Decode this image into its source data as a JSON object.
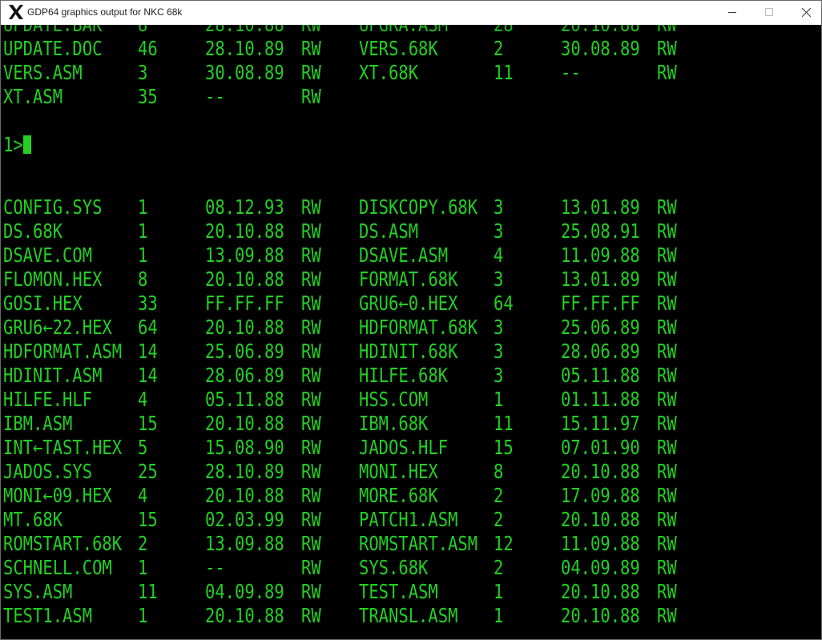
{
  "window": {
    "title": "GDP64 graphics output for NKC 68k",
    "icon": "x-app-icon",
    "controls": [
      "minimize-icon",
      "maximize-icon",
      "close-icon"
    ]
  },
  "terminal": {
    "text_color": "#22d022",
    "background": "#000000",
    "top_listing": [
      [
        "UPDATE.DOC",
        "46",
        "28.10.89",
        "RW",
        "VERS.68K",
        "2",
        "30.08.89",
        "RW"
      ],
      [
        "VERS.ASM",
        "3",
        "30.08.89",
        "RW",
        "XT.68K",
        "11",
        "--",
        "RW"
      ],
      [
        "XT.ASM",
        "35",
        "--",
        "RW",
        "",
        "",
        "",
        ""
      ]
    ],
    "prompt": "1>",
    "listing": [
      [
        "CONFIG.SYS",
        "1",
        "08.12.93",
        "RW",
        "DISKCOPY.68K",
        "3",
        "13.01.89",
        "RW"
      ],
      [
        "DS.68K",
        "1",
        "20.10.88",
        "RW",
        "DS.ASM",
        "3",
        "25.08.91",
        "RW"
      ],
      [
        "DSAVE.COM",
        "1",
        "13.09.88",
        "RW",
        "DSAVE.ASM",
        "4",
        "11.09.88",
        "RW"
      ],
      [
        "FLOMON.HEX",
        "8",
        "20.10.88",
        "RW",
        "FORMAT.68K",
        "3",
        "13.01.89",
        "RW"
      ],
      [
        "GOSI.HEX",
        "33",
        "FF.FF.FF",
        "RW",
        "GRU6←0.HEX",
        "64",
        "FF.FF.FF",
        "RW"
      ],
      [
        "GRU6←22.HEX",
        "64",
        "20.10.88",
        "RW",
        "HDFORMAT.68K",
        "3",
        "25.06.89",
        "RW"
      ],
      [
        "HDFORMAT.ASM",
        "14",
        "25.06.89",
        "RW",
        "HDINIT.68K",
        "3",
        "28.06.89",
        "RW"
      ],
      [
        "HDINIT.ASM",
        "14",
        "28.06.89",
        "RW",
        "HILFE.68K",
        "3",
        "05.11.88",
        "RW"
      ],
      [
        "HILFE.HLF",
        "4",
        "05.11.88",
        "RW",
        "HSS.COM",
        "1",
        "01.11.88",
        "RW"
      ],
      [
        "IBM.ASM",
        "15",
        "20.10.88",
        "RW",
        "IBM.68K",
        "11",
        "15.11.97",
        "RW"
      ],
      [
        "INT←TAST.HEX",
        "5",
        "15.08.90",
        "RW",
        "JADOS.HLF",
        "15",
        "07.01.90",
        "RW"
      ],
      [
        "JADOS.SYS",
        "25",
        "28.10.89",
        "RW",
        "MONI.HEX",
        "8",
        "20.10.88",
        "RW"
      ],
      [
        "MONI←09.HEX",
        "4",
        "20.10.88",
        "RW",
        "MORE.68K",
        "2",
        "17.09.88",
        "RW"
      ],
      [
        "MT.68K",
        "15",
        "02.03.99",
        "RW",
        "PATCH1.ASM",
        "2",
        "20.10.88",
        "RW"
      ],
      [
        "ROMSTART.68K",
        "2",
        "13.09.88",
        "RW",
        "ROMSTART.ASM",
        "12",
        "11.09.88",
        "RW"
      ],
      [
        "SCHNELL.COM",
        "1",
        "--",
        "RW",
        "SYS.68K",
        "2",
        "04.09.89",
        "RW"
      ],
      [
        "SYS.ASM",
        "11",
        "04.09.89",
        "RW",
        "TEST.ASM",
        "1",
        "20.10.88",
        "RW"
      ],
      [
        "TEST1.ASM",
        "1",
        "20.10.88",
        "RW",
        "TRANSL.ASM",
        "1",
        "20.10.88",
        "RW"
      ]
    ]
  }
}
